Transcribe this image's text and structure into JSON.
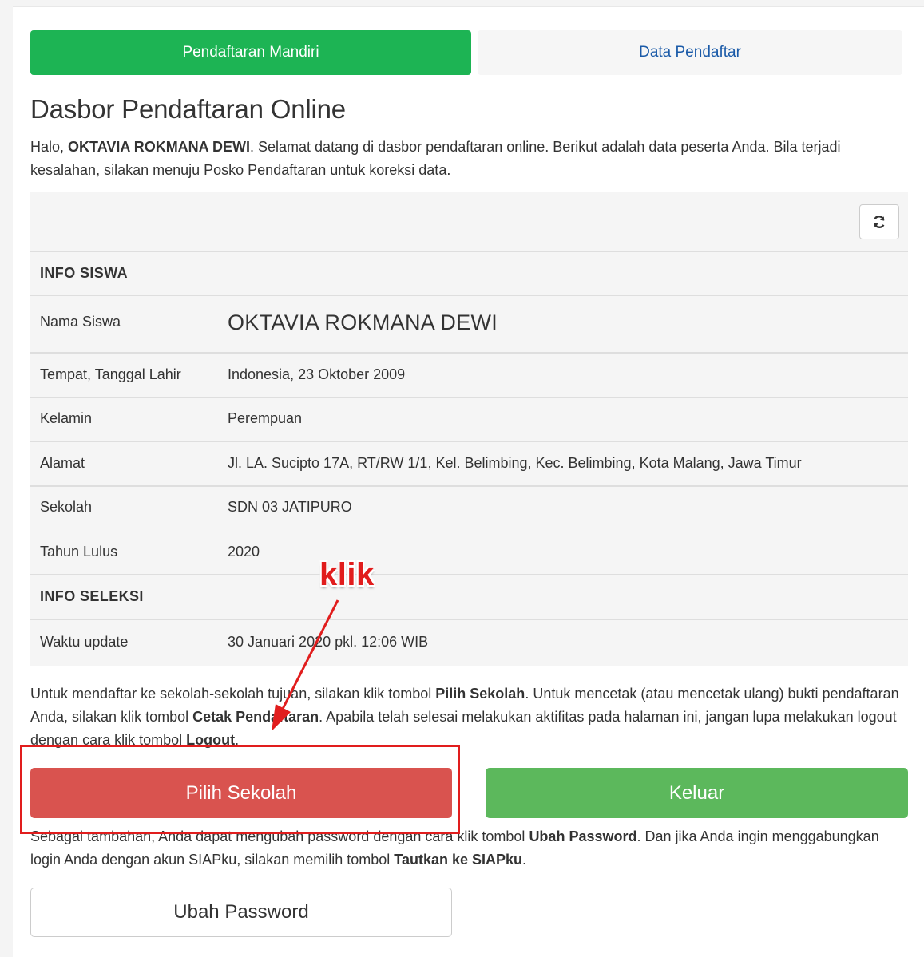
{
  "tabs": {
    "active_label": "Pendaftaran Mandiri",
    "inactive_label": "Data Pendaftar"
  },
  "page": {
    "title": "Dasbor Pendaftaran Online",
    "intro_prefix": "Halo, ",
    "intro_name": "OKTAVIA ROKMANA DEWI",
    "intro_suffix": ". Selamat datang di dasbor pendaftaran online. Berikut adalah data peserta Anda. Bila terjadi kesalahan, silakan menuju Posko Pendaftaran untuk koreksi data."
  },
  "info_siswa": {
    "heading": "INFO SISWA",
    "rows": [
      {
        "label": "Nama Siswa",
        "value": "OKTAVIA ROKMANA DEWI"
      },
      {
        "label": "Tempat, Tanggal Lahir",
        "value": "Indonesia, 23 Oktober 2009"
      },
      {
        "label": "Kelamin",
        "value": "Perempuan"
      },
      {
        "label": "Alamat",
        "value": "Jl. LA. Sucipto 17A, RT/RW 1/1, Kel. Belimbing, Kec. Belimbing, Kota Malang, Jawa Timur"
      },
      {
        "label": "Sekolah",
        "value": "SDN 03 JATIPURO"
      },
      {
        "label": "Tahun Lulus",
        "value": "2020"
      }
    ]
  },
  "info_seleksi": {
    "heading": "INFO SELEKSI",
    "rows": [
      {
        "label": "Waktu update",
        "value": "30 Januari 2020 pkl. 12:06 WIB"
      }
    ]
  },
  "para1": {
    "t1": "Untuk mendaftar ke sekolah-sekolah tujuan, silakan klik tombol ",
    "b1": "Pilih Sekolah",
    "t2": ". Untuk mencetak (atau mencetak ulang) bukti pendaftaran Anda, silakan klik tombol ",
    "b2": "Cetak Pendaftaran",
    "t3": ". Apabila telah selesai melakukan aktifitas pada halaman ini, jangan lupa melakukan logout dengan cara klik tombol ",
    "b3": "Logout",
    "t4": "."
  },
  "buttons": {
    "pilih_sekolah": "Pilih Sekolah",
    "keluar": "Keluar",
    "ubah_password": "Ubah Password"
  },
  "para2": {
    "t1": "Sebagai tambahan, Anda dapat mengubah password dengan cara klik tombol ",
    "b1": "Ubah Password",
    "t2": ". Dan jika Anda ingin menggabungkan login Anda dengan akun SIAPku, silakan memilih tombol ",
    "b2": "Tautkan ke SIAPku",
    "t3": "."
  },
  "annotation": {
    "label": "klik",
    "color": "#e11d1d"
  },
  "icons": {
    "refresh": "refresh-icon"
  },
  "colors": {
    "tab_active": "#1db454",
    "tab_inactive_text": "#1a5aa8",
    "btn_danger": "#d9534f",
    "btn_success": "#5cb85c"
  }
}
